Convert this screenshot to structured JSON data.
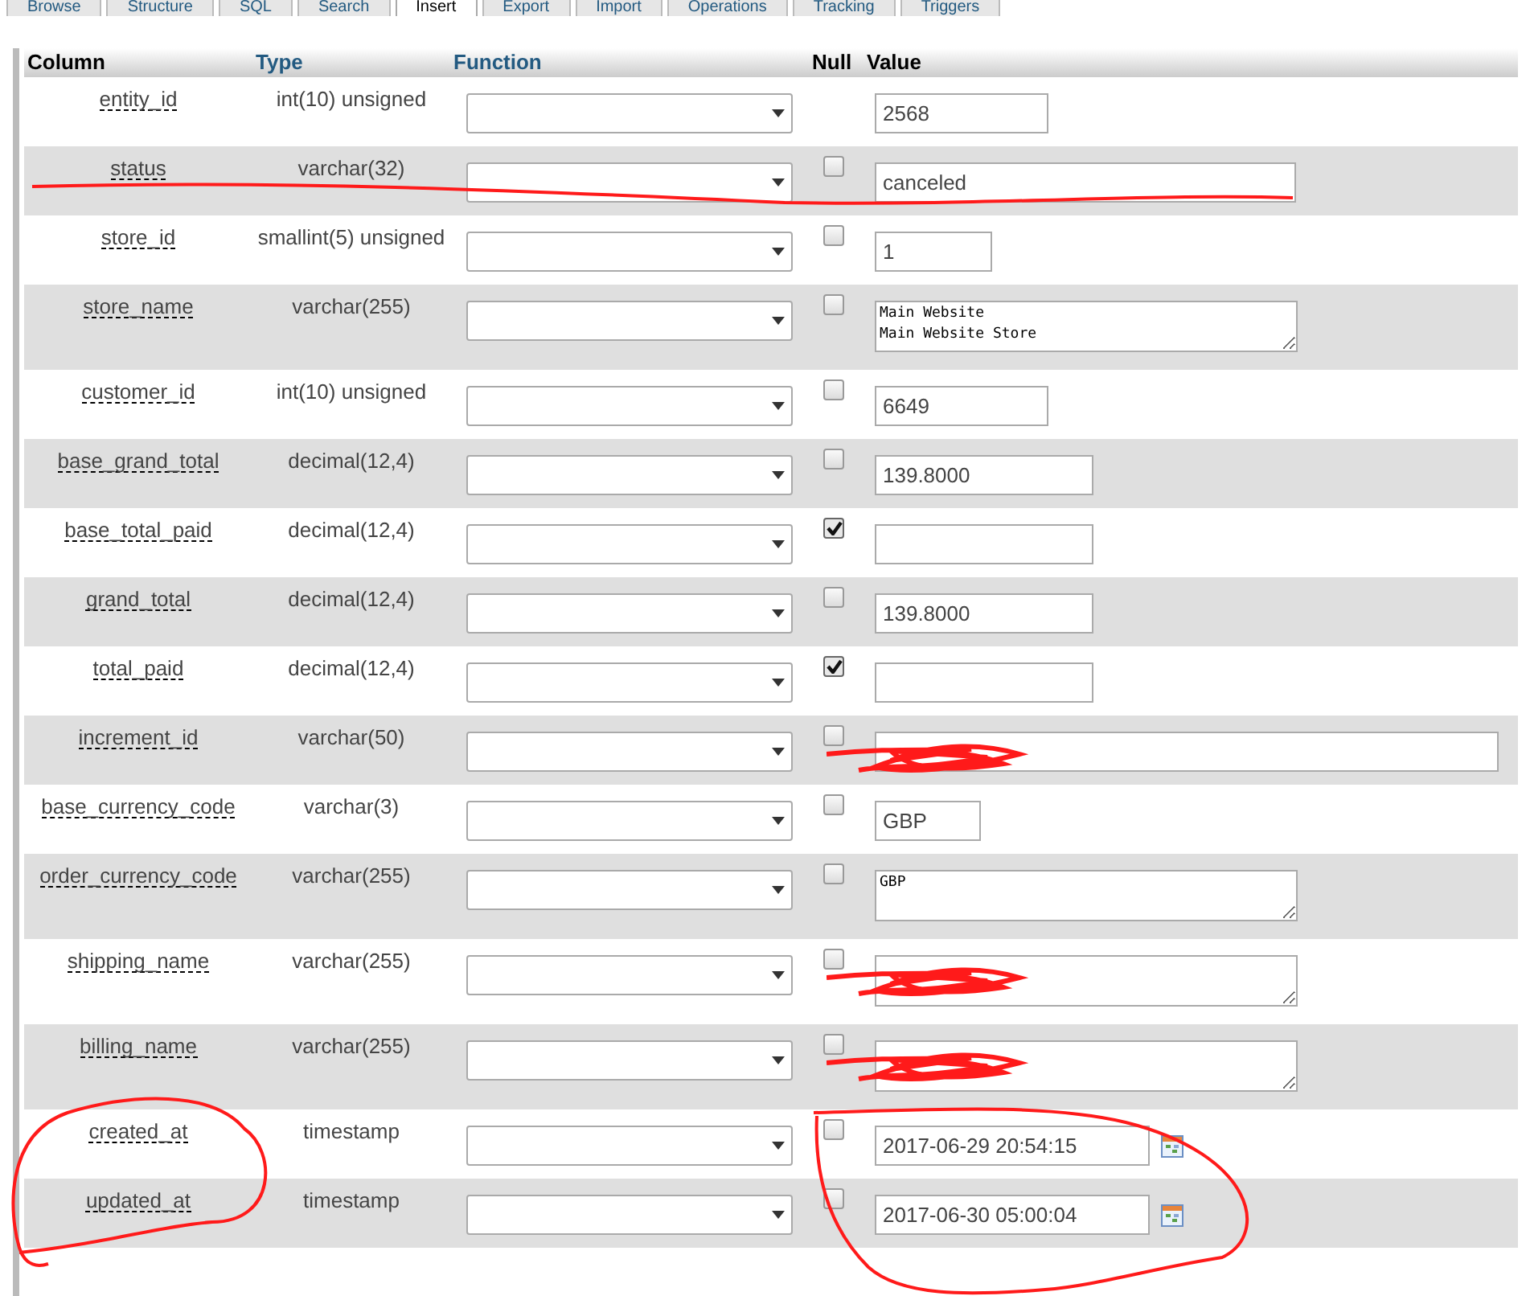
{
  "tabs": [
    {
      "label": "Browse",
      "selected": false
    },
    {
      "label": "Structure",
      "selected": false
    },
    {
      "label": "SQL",
      "selected": false
    },
    {
      "label": "Search",
      "selected": false
    },
    {
      "label": "Insert",
      "selected": true
    },
    {
      "label": "Export",
      "selected": false
    },
    {
      "label": "Import",
      "selected": false
    },
    {
      "label": "Operations",
      "selected": false
    },
    {
      "label": "Tracking",
      "selected": false
    },
    {
      "label": "Triggers",
      "selected": false
    }
  ],
  "table": {
    "columns": [
      "Column",
      "Type",
      "Function",
      "Null",
      "Value"
    ],
    "rows": [
      {
        "column": "entity_id",
        "type": "int(10) unsigned",
        "kind": "medium",
        "value": "2568"
      },
      {
        "column": "status",
        "type": "varchar(32)",
        "null_checked": false,
        "kind": "wide",
        "value": "canceled"
      },
      {
        "column": "store_id",
        "type": "smallint(5) unsigned",
        "null_checked": false,
        "kind": "small",
        "value": "1"
      },
      {
        "column": "store_name",
        "type": "varchar(255)",
        "null_checked": false,
        "kind": "textarea",
        "value": "Main Website\nMain Website Store"
      },
      {
        "column": "customer_id",
        "type": "int(10) unsigned",
        "null_checked": false,
        "kind": "medium",
        "value": "6649"
      },
      {
        "column": "base_grand_total",
        "type": "decimal(12,4)",
        "null_checked": false,
        "kind": "large",
        "value": "139.8000"
      },
      {
        "column": "base_total_paid",
        "type": "decimal(12,4)",
        "null_checked": true,
        "kind": "large"
      },
      {
        "column": "grand_total",
        "type": "decimal(12,4)",
        "null_checked": false,
        "kind": "large",
        "value": "139.8000"
      },
      {
        "column": "total_paid",
        "type": "decimal(12,4)",
        "null_checked": true,
        "kind": "large"
      },
      {
        "column": "increment_id",
        "type": "varchar(50)",
        "null_checked": false,
        "kind": "full",
        "redacted": true
      },
      {
        "column": "base_currency_code",
        "type": "varchar(3)",
        "null_checked": false,
        "kind": "tiny",
        "value": "GBP"
      },
      {
        "column": "order_currency_code",
        "type": "varchar(255)",
        "null_checked": false,
        "kind": "textarea",
        "value": "GBP"
      },
      {
        "column": "shipping_name",
        "type": "varchar(255)",
        "null_checked": false,
        "kind": "textarea",
        "redacted": true
      },
      {
        "column": "billing_name",
        "type": "varchar(255)",
        "null_checked": false,
        "kind": "textarea",
        "redacted": true
      },
      {
        "column": "created_at",
        "type": "timestamp",
        "null_checked": false,
        "kind": "datetime",
        "value": "2017-06-29 20:54:15"
      },
      {
        "column": "updated_at",
        "type": "timestamp",
        "null_checked": false,
        "kind": "datetime",
        "value": "2017-06-30 05:00:04"
      }
    ]
  }
}
